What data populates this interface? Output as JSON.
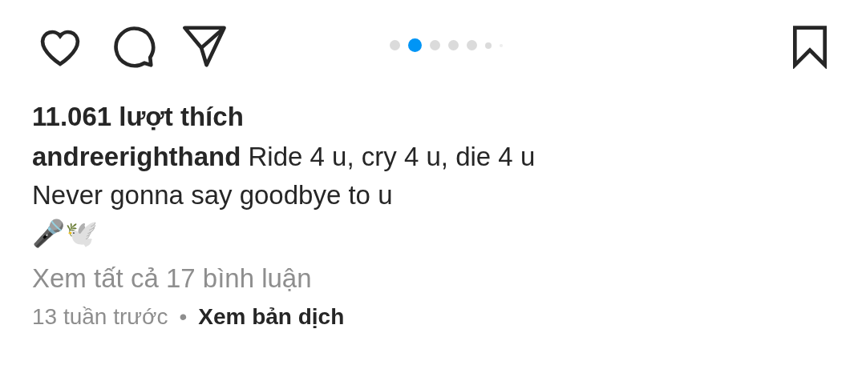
{
  "carousel": {
    "dots": [
      {
        "selected": false
      },
      {
        "selected": true
      },
      {
        "selected": false
      },
      {
        "selected": false
      },
      {
        "selected": false
      },
      {
        "selected": false
      },
      {
        "selected": false
      }
    ]
  },
  "likes": "11.061 lượt thích",
  "caption": {
    "username": "andreerighthand",
    "lines": [
      "Ride 4 u, cry 4 u, die 4 u",
      "Never gonna say goodbye to u",
      "🎤🕊️"
    ]
  },
  "view_comments": "Xem tất cả 17 bình luận",
  "footer": {
    "time": "13 tuần trước",
    "separator": "•",
    "translate": "Xem bản dịch"
  }
}
